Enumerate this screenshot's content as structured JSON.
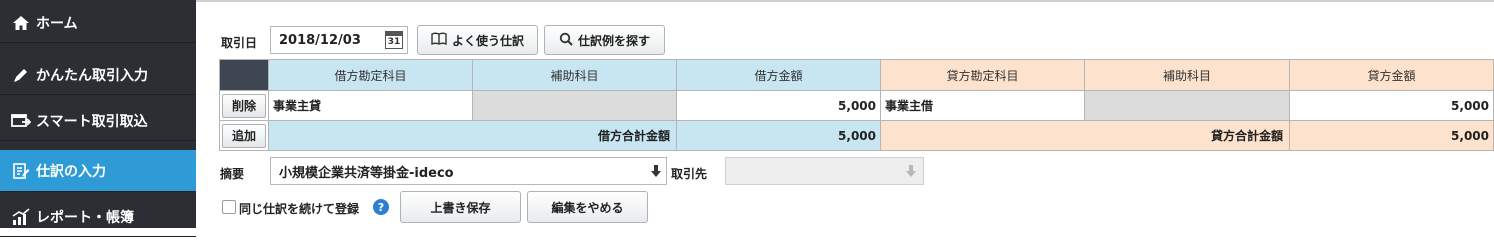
{
  "sidebar": {
    "items": [
      {
        "label": "ホーム",
        "icon": "home-icon"
      },
      {
        "label": "かんたん取引入力",
        "icon": "pencil-icon"
      },
      {
        "label": "スマート取引取込",
        "icon": "import-icon"
      },
      {
        "label": "仕訳の入力",
        "icon": "journal-icon"
      },
      {
        "label": "レポート・帳簿",
        "icon": "chart-icon"
      }
    ],
    "active_index": 3
  },
  "toolbar": {
    "date_label": "取引日",
    "date_value": "2018/12/03",
    "calendar_icon_text": "31",
    "frequent_button": "よく使う仕訳",
    "search_button": "仕訳例を探す"
  },
  "table": {
    "headers": [
      "借方勘定科目",
      "補助科目",
      "借方金額",
      "貸方勘定科目",
      "補助科目",
      "貸方金額"
    ],
    "rows": [
      {
        "action": "削除",
        "debit_account": "事業主貸",
        "debit_sub": "",
        "debit_amount": "5,000",
        "credit_account": "事業主借",
        "credit_sub": "",
        "credit_amount": "5,000"
      }
    ],
    "add_label": "追加",
    "debit_total_label": "借方合計金額",
    "debit_total": "5,000",
    "credit_total_label": "貸方合計金額",
    "credit_total": "5,000"
  },
  "memo": {
    "label": "摘要",
    "value": "小規模企業共済等掛金-ideco"
  },
  "partner": {
    "label": "取引先",
    "value": ""
  },
  "footer": {
    "repeat_label": "同じ仕訳を続けて登録",
    "save_button": "上書き保存",
    "cancel_button": "編集をやめる"
  },
  "colors": {
    "sidebar_bg": "#2b2f33",
    "active_item": "#2f9bd6",
    "debit_bg": "#c8e6f2",
    "credit_bg": "#fde2cd",
    "header_corner": "#3d4651"
  }
}
